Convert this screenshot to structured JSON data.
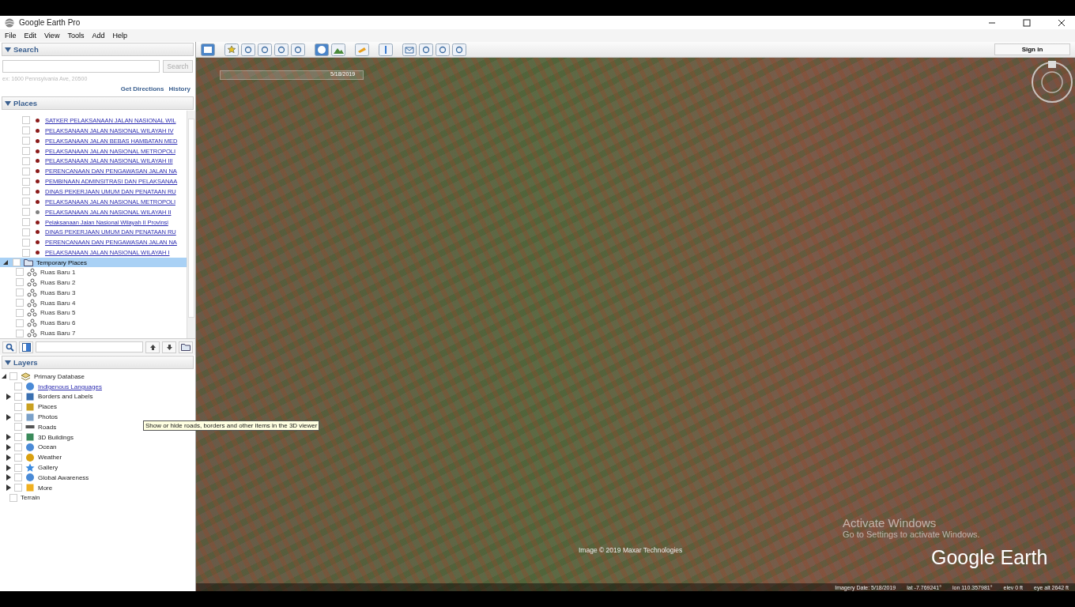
{
  "window": {
    "title": "Google Earth Pro"
  },
  "menu": [
    "File",
    "Edit",
    "View",
    "Tools",
    "Add",
    "Help"
  ],
  "search": {
    "title": "Search",
    "button": "Search",
    "example": "ex: 1600 Pennsylvania Ave, 20500",
    "links": [
      "Get Directions",
      "History"
    ]
  },
  "places": {
    "title": "Places",
    "items": [
      {
        "label": "SATKER PELAKSANAAN JALAN NASIONAL WIL",
        "checked": false,
        "color": "#8b1a1a"
      },
      {
        "label": "PELAKSANAAN JALAN NASIONAL WILAYAH IV",
        "checked": false,
        "color": "#8b1a1a"
      },
      {
        "label": "PELAKSANAAN JALAN BEBAS HAMBATAN MED",
        "checked": false,
        "color": "#8b1a1a"
      },
      {
        "label": "PELAKSANAAN JALAN NASIONAL METROPOLI",
        "checked": false,
        "color": "#8b1a1a"
      },
      {
        "label": "PELAKSANAAN JALAN NASIONAL WILAYAH III",
        "checked": false,
        "color": "#8b1a1a"
      },
      {
        "label": "PERENCANAAN DAN PENGAWASAN JALAN NA",
        "checked": false,
        "color": "#8b1a1a"
      },
      {
        "label": "PEMBINAAN ADMINSITRASI DAN PELAKSANAA",
        "checked": false,
        "color": "#8b1a1a"
      },
      {
        "label": "DINAS PEKERJAAN UMUM DAN PENATAAN RU",
        "checked": false,
        "color": "#8b1a1a"
      },
      {
        "label": "PELAKSANAAN JALAN NASIONAL METROPOLI",
        "checked": false,
        "color": "#8b1a1a"
      },
      {
        "label": "PELAKSANAAN JALAN NASIONAL WILAYAH II",
        "checked": false,
        "color": "#808080"
      },
      {
        "label": "Pelaksanaan Jalan Nasional Wilayah II Provinsi",
        "checked": false,
        "color": "#8b1a1a"
      },
      {
        "label": "DINAS PEKERJAAN UMUM DAN PENATAAN RU",
        "checked": false,
        "color": "#8b1a1a"
      },
      {
        "label": "PERENCANAAN DAN PENGAWASAN JALAN NA",
        "checked": false,
        "color": "#8b1a1a"
      },
      {
        "label": "PELAKSANAAN JALAN NASIONAL WILAYAH I",
        "checked": false,
        "color": "#8b1a1a"
      }
    ],
    "temporary": {
      "label": "Temporary Places",
      "selected": true,
      "checked": false,
      "expanded": true,
      "children": [
        {
          "label": "Ruas Baru 1",
          "checked": false
        },
        {
          "label": "Ruas Baru 2",
          "checked": false
        },
        {
          "label": "Ruas Baru 3",
          "checked": false
        },
        {
          "label": "Ruas Baru 4",
          "checked": false
        },
        {
          "label": "Ruas Baru 5",
          "checked": false
        },
        {
          "label": "Ruas Baru 6",
          "checked": false
        },
        {
          "label": "Ruas Baru 7",
          "checked": false
        }
      ]
    }
  },
  "layers": {
    "title": "Layers",
    "tree": [
      {
        "label": "Primary Database",
        "checked": false,
        "expanded": true,
        "children": [
          {
            "label": "Indigenous Languages",
            "kind": "link",
            "checked": false
          },
          {
            "label": "Borders and Labels",
            "kind": "item",
            "checked": false,
            "expanded": false
          },
          {
            "label": "Places",
            "kind": "item",
            "checked": false
          },
          {
            "label": "Photos",
            "kind": "item",
            "checked": false,
            "expanded": false
          },
          {
            "label": "Roads",
            "kind": "item",
            "checked": false
          },
          {
            "label": "3D Buildings",
            "kind": "item",
            "checked": false,
            "expanded": false
          },
          {
            "label": "Ocean",
            "kind": "item",
            "checked": false,
            "expanded": false
          },
          {
            "label": "Weather",
            "kind": "item",
            "checked": false,
            "expanded": false
          },
          {
            "label": "Gallery",
            "kind": "item",
            "checked": false,
            "expanded": false
          },
          {
            "label": "Global Awareness",
            "kind": "item",
            "checked": false,
            "expanded": false
          },
          {
            "label": "More",
            "kind": "item",
            "checked": false,
            "expanded": false
          }
        ]
      },
      {
        "label": "Terrain",
        "checked": false
      }
    ]
  },
  "tooltip": "Show or hide roads, borders and other items in the 3D viewer",
  "toolbar": {
    "sign_in": "Sign in"
  },
  "map": {
    "date": "5/18/2019",
    "attribution": "Image © 2019 Maxar Technologies",
    "logo": "Google Earth",
    "status": [
      "Imagery Date: 5/18/2019",
      "lat  -7.769241°",
      "lon  110.357981°",
      "elev   0 ft",
      "eye alt  2642 ft"
    ],
    "notice": [
      "Activate Windows",
      "Go to Settings to activate Windows."
    ]
  }
}
